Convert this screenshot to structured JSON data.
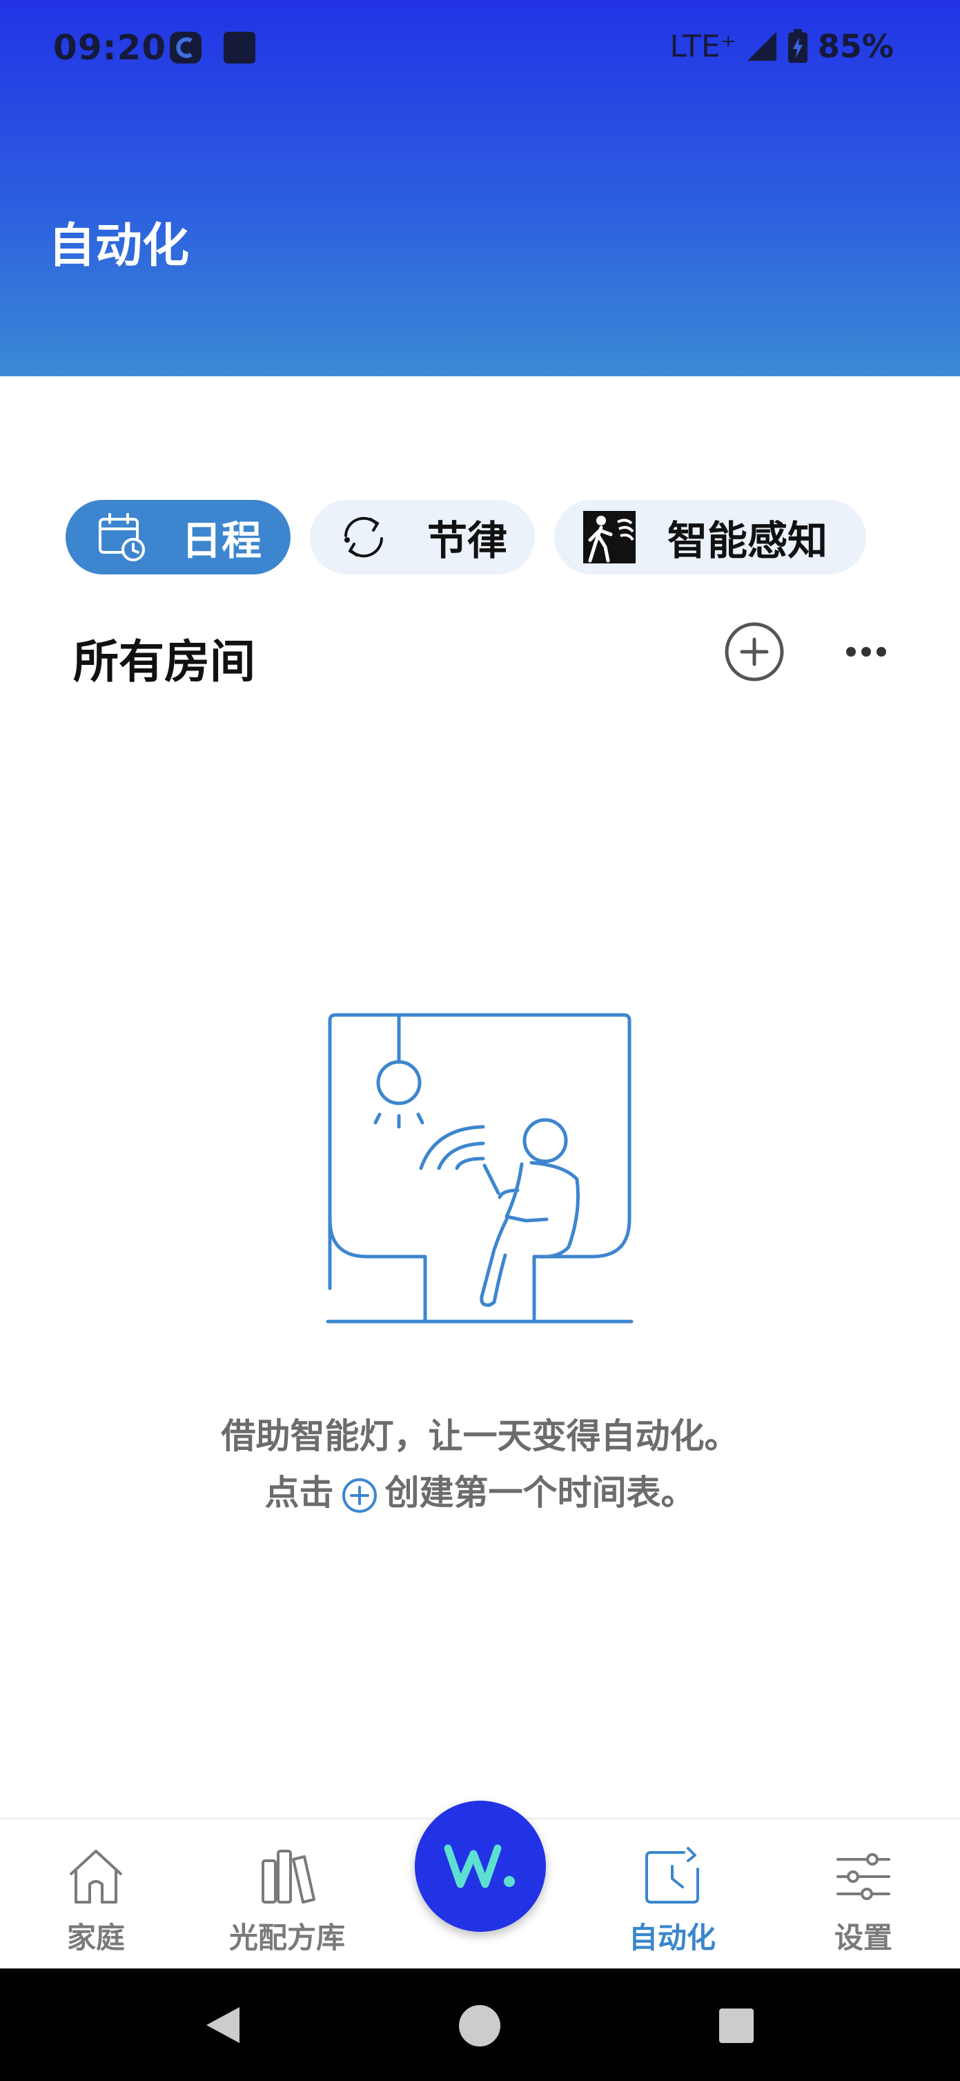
{
  "status_bar": {
    "time": "09:20",
    "network": "LTE⁺",
    "battery": "85%"
  },
  "header": {
    "title": "自动化"
  },
  "tabs": [
    {
      "label": "日程",
      "icon": "calendar-clock-icon",
      "active": true
    },
    {
      "label": "节律",
      "icon": "cycle-arrows-icon",
      "active": false
    },
    {
      "label": "智能感知",
      "icon": "motion-sensor-icon",
      "active": false
    }
  ],
  "section": {
    "title": "所有房间"
  },
  "empty_state": {
    "line1": "借助智能灯，让一天变得自动化。",
    "line2_before": "点击",
    "line2_after": "创建第一个时间表。"
  },
  "bottom_nav": [
    {
      "label": "家庭",
      "icon": "house-icon",
      "active": false
    },
    {
      "label": "光配方库",
      "icon": "books-icon",
      "active": false
    },
    {
      "label": "自动化",
      "icon": "clock-refresh-icon",
      "active": true
    },
    {
      "label": "设置",
      "icon": "sliders-icon",
      "active": false
    }
  ],
  "colors": {
    "accent": "#3d86cf",
    "fab": "#2233e6",
    "fab_logo": "#5ee0d0",
    "header_gradient_top": "#2233e6",
    "header_gradient_bottom": "#3a8ad4"
  }
}
